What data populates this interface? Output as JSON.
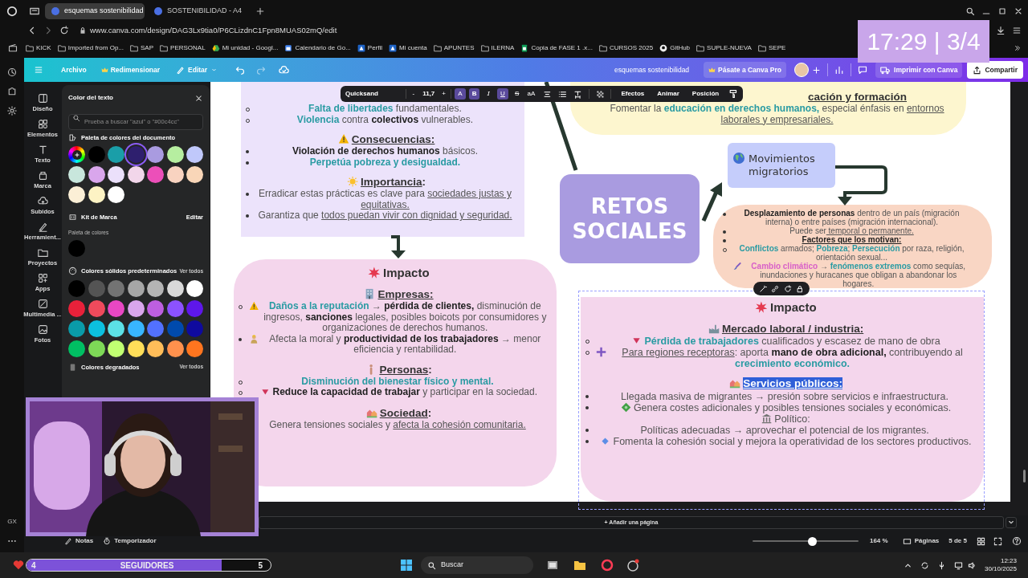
{
  "browser": {
    "tabs": [
      {
        "title": "esquemas sostenibilidad",
        "selected": true
      },
      {
        "title": "SOSTENIBILIDAD - A4",
        "selected": false
      }
    ],
    "address": "www.canva.com/design/DAG3Lx9tia0/P6CLizdnC1Fpn8MUAS02mQ/edit",
    "bookmarks": [
      {
        "label": "KICK",
        "kind": "folder"
      },
      {
        "label": "Imported from Op...",
        "kind": "folder"
      },
      {
        "label": "SAP",
        "kind": "folder"
      },
      {
        "label": "PERSONAL",
        "kind": "folder"
      },
      {
        "label": "Mi unidad - Googl...",
        "kind": "drive"
      },
      {
        "label": "Calendario de Go...",
        "kind": "calendar"
      },
      {
        "label": "Perfil",
        "kind": "site"
      },
      {
        "label": "Mi cuenta",
        "kind": "site"
      },
      {
        "label": "APUNTES",
        "kind": "folder"
      },
      {
        "label": "ILERNA",
        "kind": "folder"
      },
      {
        "label": "Copia de FASE 1 .x...",
        "kind": "sheet"
      },
      {
        "label": "CURSOS 2025",
        "kind": "folder"
      },
      {
        "label": "GitHub",
        "kind": "github"
      },
      {
        "label": "SUPLE-NUEVA",
        "kind": "folder"
      },
      {
        "label": "SEPE",
        "kind": "folder"
      }
    ],
    "side_label": "GX"
  },
  "stream_overlay": {
    "clock": "17:29 | 3/4",
    "followers": {
      "count": "4",
      "label": "SEGUIDORES",
      "goal": "5",
      "level": 0.8
    }
  },
  "canva_header": {
    "menu": [
      "Archivo",
      "Redimensionar",
      "Editar"
    ],
    "doc_title": "esquemas sostenibilidad",
    "upgrade": "Pásate a Canva Pro",
    "print": "Imprimir con Canva",
    "share": "Compartir"
  },
  "rail": [
    "Diseño",
    "Elementos",
    "Texto",
    "Marca",
    "Subidos",
    "Herramient...",
    "Proyectos",
    "Apps",
    "Multimedia ...",
    "Fotos"
  ],
  "color_panel": {
    "title": "Color del texto",
    "search": {
      "placeholder": "Prueba a buscar \"azul\" o \"#00c4cc\""
    },
    "document_palette": {
      "label": "Paleta de colores del documento",
      "swatches": [
        {
          "kind": "add"
        },
        {
          "kind": "color",
          "color": "#000000",
          "selected": false
        },
        {
          "kind": "color",
          "color": "#1a9ea8",
          "selected": false
        },
        {
          "kind": "color",
          "color": "#2e1f6e",
          "selected": true
        },
        {
          "kind": "color",
          "color": "#a99be0",
          "selected": false
        },
        {
          "kind": "color",
          "color": "#b6eea0",
          "selected": false
        },
        {
          "kind": "color",
          "color": "#c0c8fb",
          "selected": false
        },
        {
          "kind": "color",
          "color": "#c8e6dc",
          "selected": false
        },
        {
          "kind": "color",
          "color": "#d9a6ec",
          "selected": false
        },
        {
          "kind": "color",
          "color": "#ebe0fb",
          "selected": false
        },
        {
          "kind": "color",
          "color": "#f2d6ea",
          "selected": false
        },
        {
          "kind": "color",
          "color": "#ec4fb9",
          "selected": false
        },
        {
          "kind": "color",
          "color": "#f8d3c0",
          "selected": false
        },
        {
          "kind": "color",
          "color": "#f9d6b8",
          "selected": false
        },
        {
          "kind": "color",
          "color": "#fbefd6",
          "selected": false
        },
        {
          "kind": "color",
          "color": "#fdf3c4",
          "selected": false
        },
        {
          "kind": "color",
          "color": "#ffffff",
          "selected": false
        }
      ]
    },
    "brand_kit": {
      "label": "Kit de Marca",
      "edit": "Editar",
      "palette_label": "Paleta de colores",
      "swatches": [
        {
          "color": "#000000",
          "selected": false
        }
      ]
    },
    "solid": {
      "label": "Colores sólidos predeterminados",
      "more": "Ver todos",
      "swatches": [
        {
          "color": "#000000",
          "selected": false
        },
        {
          "color": "#545454",
          "selected": false
        },
        {
          "color": "#737373",
          "selected": false
        },
        {
          "color": "#a6a6a6",
          "selected": false
        },
        {
          "color": "#b4b4b4",
          "selected": false
        },
        {
          "color": "#d9d9d9",
          "selected": false
        },
        {
          "color": "#ffffff",
          "selected": false
        },
        {
          "color": "#e8213a",
          "selected": false
        },
        {
          "color": "#f04a5c",
          "selected": false
        },
        {
          "color": "#e847c3",
          "selected": false
        },
        {
          "color": "#d9a6ec",
          "selected": false
        },
        {
          "color": "#bd5fe0",
          "selected": false
        },
        {
          "color": "#8c52ff",
          "selected": false
        },
        {
          "color": "#5e17eb",
          "selected": false
        },
        {
          "color": "#0a9ba8",
          "selected": false
        },
        {
          "color": "#0cc0df",
          "selected": false
        },
        {
          "color": "#5ce1e6",
          "selected": false
        },
        {
          "color": "#38b6ff",
          "selected": false
        },
        {
          "color": "#5271ff",
          "selected": false
        },
        {
          "color": "#004aad",
          "selected": false
        },
        {
          "color": "#0f0a9e",
          "selected": false
        },
        {
          "color": "#00bf63",
          "selected": false
        },
        {
          "color": "#7ed957",
          "selected": false
        },
        {
          "color": "#c1ff72",
          "selected": false
        },
        {
          "color": "#ffde59",
          "selected": false
        },
        {
          "color": "#ffbd59",
          "selected": false
        },
        {
          "color": "#ff914d",
          "selected": false
        },
        {
          "color": "#ff751f",
          "selected": false
        }
      ]
    },
    "gradients": {
      "label": "Colores degradados",
      "more": "Ver todos"
    }
  },
  "text_toolbar": {
    "font": "Quicksand",
    "minus": "-",
    "size": "11,7",
    "plus": "+",
    "format": [
      {
        "kind": "color",
        "label": "A",
        "on": true
      },
      {
        "kind": "bold",
        "label": "B",
        "on": true
      },
      {
        "kind": "italic",
        "label": "I",
        "on": false
      },
      {
        "kind": "underline",
        "label": "U",
        "on": true
      },
      {
        "kind": "strike",
        "label": "S",
        "on": false
      },
      {
        "kind": "case",
        "label": "aA",
        "on": false
      }
    ],
    "actions": [
      "Efectos",
      "Animar",
      "Posición"
    ]
  },
  "design": {
    "upper_box": [
      {
        "kind": "circle",
        "runs": [
          {
            "kind": "teal",
            "text": "Falta de libertades"
          },
          {
            "kind": "plain",
            "text": " fundamentales."
          }
        ]
      },
      {
        "kind": "circle",
        "runs": [
          {
            "kind": "teal",
            "text": "Violencia"
          },
          {
            "kind": "plain",
            "text": " contra "
          },
          {
            "kind": "bold",
            "text": "colectivos"
          },
          {
            "kind": "plain",
            "text": " vulnerables."
          }
        ]
      },
      {
        "kind": "heading",
        "runs": [
          {
            "kind": "icon"
          },
          {
            "kind": "underline",
            "text": "Consecuencias:"
          }
        ]
      },
      {
        "kind": "disc",
        "runs": [
          {
            "kind": "bold",
            "text": "Violación de derechos humanos"
          },
          {
            "kind": "plain",
            "text": " básicos."
          }
        ]
      },
      {
        "kind": "disc",
        "runs": [
          {
            "kind": "teal",
            "text": "Perpetúa pobreza y desigualdad."
          }
        ]
      },
      {
        "kind": "heading",
        "runs": [
          {
            "kind": "icon"
          },
          {
            "kind": "underline",
            "text": "Importancia"
          },
          {
            "kind": "plain",
            "text": ":"
          }
        ]
      },
      {
        "kind": "disc",
        "runs": [
          {
            "kind": "plain",
            "text": "Erradicar estas prácticas es clave para "
          },
          {
            "kind": "underline",
            "text": "sociedades justas y equitativas."
          }
        ]
      },
      {
        "kind": "disc",
        "runs": [
          {
            "kind": "plain",
            "text": "Garantiza que "
          },
          {
            "kind": "underline",
            "text": "todos puedan vivir con dignidad y seguridad."
          }
        ]
      }
    ],
    "impact_left": [
      {
        "kind": "title",
        "runs": [
          {
            "kind": "icon"
          },
          {
            "kind": "plain",
            "text": "Impacto"
          }
        ]
      },
      {
        "kind": "heading",
        "runs": [
          {
            "kind": "icon"
          },
          {
            "kind": "underline",
            "text": "Empresas:"
          }
        ]
      },
      {
        "kind": "circle",
        "runs": [
          {
            "kind": "icon"
          },
          {
            "kind": "teal",
            "text": "Daños a la reputación"
          },
          {
            "kind": "plain",
            "text": " → "
          },
          {
            "kind": "bold",
            "text": "pérdida de clientes,"
          },
          {
            "kind": "plain",
            "text": " disminución de ingresos, "
          },
          {
            "kind": "bold",
            "text": "sanciones"
          },
          {
            "kind": "plain",
            "text": " legales, posibles boicots por consumidores y organizaciones de derechos humanos."
          }
        ]
      },
      {
        "kind": "disc",
        "runs": [
          {
            "kind": "icon"
          },
          {
            "kind": "plain",
            "text": "Afecta la moral y "
          },
          {
            "kind": "bold",
            "text": "productividad de los trabajadores"
          },
          {
            "kind": "plain",
            "text": " → menor eficiencia y rentabilidad."
          }
        ]
      },
      {
        "kind": "heading",
        "runs": [
          {
            "kind": "icon"
          },
          {
            "kind": "underline",
            "text": "Personas"
          },
          {
            "kind": "plain",
            "text": ":"
          }
        ]
      },
      {
        "kind": "circle",
        "runs": [
          {
            "kind": "teal",
            "text": "Disminución del bienestar físico y mental."
          }
        ]
      },
      {
        "kind": "circle",
        "runs": [
          {
            "kind": "icon"
          },
          {
            "kind": "bold",
            "text": "Reduce la capacidad de trabajar"
          },
          {
            "kind": "plain",
            "text": " y participar en la sociedad."
          }
        ]
      },
      {
        "kind": "heading",
        "runs": [
          {
            "kind": "icon"
          },
          {
            "kind": "underline",
            "text": "Sociedad"
          },
          {
            "kind": "plain",
            "text": ":"
          }
        ]
      },
      {
        "kind": "plain",
        "runs": [
          {
            "kind": "plain",
            "text": "Genera tensiones sociales y "
          },
          {
            "kind": "underline",
            "text": "afecta la cohesión comunitaria."
          }
        ]
      }
    ],
    "education_box": [
      {
        "kind": "heading",
        "runs": [
          {
            "kind": "underline",
            "text": "cación y formación"
          }
        ]
      },
      {
        "kind": "plain",
        "runs": [
          {
            "kind": "plain",
            "text": "Fomentar la "
          },
          {
            "kind": "teal",
            "text": "educación en derechos humanos,"
          },
          {
            "kind": "plain",
            "text": " especial énfasis en "
          },
          {
            "kind": "underline",
            "text": "entornos laborales y empresariales."
          }
        ]
      }
    ],
    "center_title": "RETOS SOCIALES",
    "migration_title": "Movimientos migratorios",
    "migration_box": [
      {
        "kind": "disc",
        "runs": [
          {
            "kind": "bold",
            "text": "Desplazamiento de personas"
          },
          {
            "kind": "plain",
            "text": " dentro de un país (migración interna) o entre países (migración internacional)."
          }
        ]
      },
      {
        "kind": "disc",
        "runs": [
          {
            "kind": "plain",
            "text": "Puede ser"
          },
          {
            "kind": "underline",
            "text": " temporal o permanente."
          }
        ]
      },
      {
        "kind": "disc",
        "runs": [
          {
            "kind": "boldunderline",
            "text": "Factores que los motivan:"
          }
        ]
      },
      {
        "kind": "circle",
        "runs": [
          {
            "kind": "teal",
            "text": "Conflictos"
          },
          {
            "kind": "plain",
            "text": " armados; "
          },
          {
            "kind": "teal",
            "text": "Pobreza"
          },
          {
            "kind": "plain",
            "text": "; "
          },
          {
            "kind": "teal",
            "text": "Persecución"
          },
          {
            "kind": "plain",
            "text": " por raza, religión, orientación sexual..."
          },
          {
            "kind": "icon"
          },
          {
            "kind": "pink",
            "text": "Cambio climático"
          },
          {
            "kind": "plain",
            "text": " → "
          },
          {
            "kind": "teal",
            "text": "fenómenos extremos"
          },
          {
            "kind": "plain",
            "text": " como sequías, inundaciones y huracanes que obligan a abandonar los hogares."
          }
        ]
      }
    ],
    "impact_right": [
      {
        "kind": "title",
        "runs": [
          {
            "kind": "icon"
          },
          {
            "kind": "plain",
            "text": "Impacto"
          }
        ]
      },
      {
        "kind": "heading",
        "runs": [
          {
            "kind": "icon"
          },
          {
            "kind": "underline",
            "text": "Mercado laboral / industria:"
          }
        ]
      },
      {
        "kind": "circle",
        "runs": [
          {
            "kind": "icon"
          },
          {
            "kind": "teal",
            "text": "Pérdida de trabajadores"
          },
          {
            "kind": "plain",
            "text": " cualificados y escasez de mano de obra"
          }
        ]
      },
      {
        "kind": "circle",
        "runs": [
          {
            "kind": "icon"
          },
          {
            "kind": "underline",
            "text": " Para regiones receptoras"
          },
          {
            "kind": "plain",
            "text": ": aporta "
          },
          {
            "kind": "bold",
            "text": "mano de obra adicional,"
          },
          {
            "kind": "plain",
            "text": " contribuyendo al "
          },
          {
            "kind": "teal",
            "text": "crecimiento económico."
          }
        ]
      },
      {
        "kind": "heading",
        "runs": [
          {
            "kind": "icon"
          },
          {
            "kind": "highlight",
            "text": "Servicios públicos:"
          }
        ]
      },
      {
        "kind": "disc",
        "runs": [
          {
            "kind": "plain",
            "text": "Llegada masiva de migrantes → presión sobre servicios e infraestructura."
          }
        ]
      },
      {
        "kind": "disc",
        "runs": [
          {
            "kind": "icon"
          },
          {
            "kind": "plain",
            "text": "Genera costes adicionales y posibles tensiones sociales y económicas."
          }
        ]
      },
      {
        "kind": "plain",
        "runs": [
          {
            "kind": "icon"
          },
          {
            "kind": "plain",
            "text": "Político:"
          }
        ]
      },
      {
        "kind": "disc",
        "runs": [
          {
            "kind": "plain",
            "text": "Políticas adecuadas → aprovechar el potencial de los migrantes."
          }
        ]
      },
      {
        "kind": "disc",
        "runs": [
          {
            "kind": "icon"
          },
          {
            "kind": "plain",
            "text": "Fomenta la cohesión social y mejora la operatividad de los sectores productivos."
          }
        ]
      }
    ]
  },
  "footer": {
    "add_page": "+ Añadir una página",
    "notes": "Notas",
    "timer": "Temporizador",
    "zoom_slider": {
      "level": 0.56
    },
    "zoom": "164 %",
    "pages": "Páginas",
    "page_count": "5 de 5"
  },
  "taskbar": {
    "search": "Buscar",
    "time": "12:23",
    "date": "30/10/2025"
  }
}
